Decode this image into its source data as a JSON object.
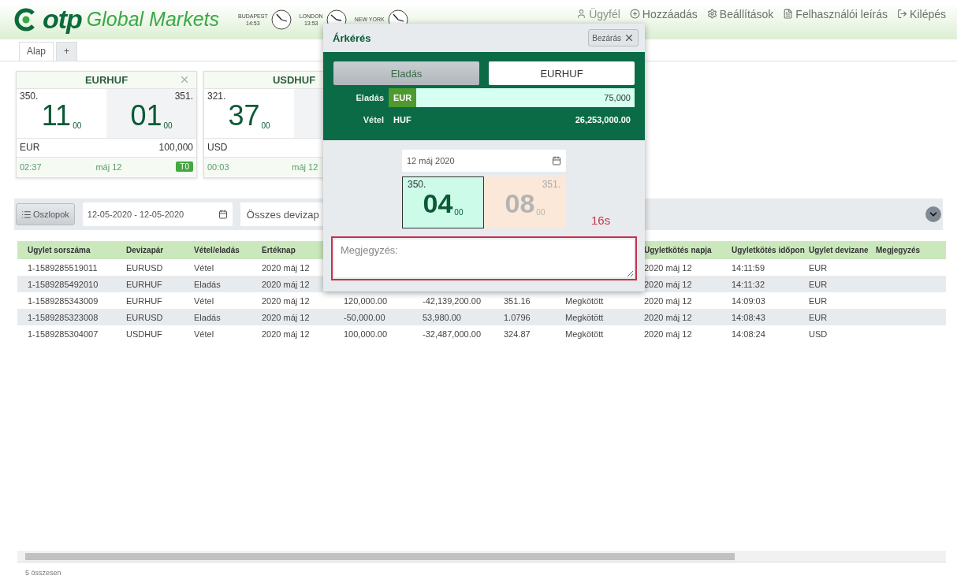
{
  "logo": {
    "brand": "otp",
    "product": "Global Markets"
  },
  "clocks": [
    {
      "city": "BUDAPEST",
      "time": "14:53"
    },
    {
      "city": "LONDON",
      "time": "13:53"
    },
    {
      "city": "NEW YORK"
    }
  ],
  "nav": [
    {
      "kind": "user",
      "label": "Ügyfél",
      "disabled": true
    },
    {
      "kind": "add",
      "label": "Hozzáadás",
      "disabled": false
    },
    {
      "kind": "settings",
      "label": "Beállítások",
      "disabled": false
    },
    {
      "kind": "manual",
      "label": "Felhasználói leírás",
      "disabled": false
    },
    {
      "kind": "logout",
      "label": "Kilépés",
      "disabled": false
    }
  ],
  "tabs": [
    {
      "label": "Alap",
      "selected": true
    },
    {
      "label": "+",
      "selected": false
    }
  ],
  "cards": [
    {
      "pair": "EURHUF",
      "bid": {
        "prefix": "350.",
        "big": "11",
        "small": "00"
      },
      "ask": {
        "prefix": "351.",
        "big": "01",
        "small": "00"
      },
      "currency": "EUR",
      "amount": "100,000",
      "time": "02:37",
      "date": "máj 12",
      "badge": "T0"
    },
    {
      "pair": "USDHUF",
      "bid": {
        "prefix": "321.",
        "big": "37",
        "small": "00"
      },
      "currency": "USD",
      "time": "00:03",
      "date": "máj 12"
    }
  ],
  "toolbar": {
    "columns_button": "Oszlopok",
    "date_range": "12-05-2020 - 12-05-2020",
    "pair_filter": "Összes devizap"
  },
  "table": {
    "columns": [
      "Ügylet sorszáma",
      "Devizapár",
      "Vétel/eladás",
      "Értéknap",
      null,
      null,
      null,
      null,
      "Ügyletkötés napja",
      "Ügyletkötés időpon",
      "Ügylet devizane",
      "Megjegyzés"
    ],
    "rows": [
      [
        "1-1589285519011",
        "EURUSD",
        "Vétel",
        "2020 máj 12",
        null,
        null,
        null,
        null,
        "2020 máj 12",
        "14:11:59",
        "EUR",
        null
      ],
      [
        "1-1589285492010",
        "EURHUF",
        "Eladás",
        "2020 máj 12",
        null,
        null,
        null,
        null,
        "2020 máj 12",
        "14:11:32",
        "EUR",
        null
      ],
      [
        "1-1589285343009",
        "EURHUF",
        "Vétel",
        "2020 máj 12",
        "120,000.00",
        "-42,139,200.00",
        "351.16",
        "Megkötött",
        "2020 máj 12",
        "14:09:03",
        "EUR",
        null
      ],
      [
        "1-1589285323008",
        "EURUSD",
        "Eladás",
        "2020 máj 12",
        "-50,000.00",
        "53,980.00",
        "1.0796",
        "Megkötött",
        "2020 máj 12",
        "14:08:43",
        "EUR",
        null
      ],
      [
        "1-1589285304007",
        "USDHUF",
        "Vétel",
        "2020 máj 12",
        "100,000.00",
        "-32,487,000.00",
        "324.87",
        "Megkötött",
        "2020 máj 12",
        "14:08:24",
        "USD",
        null
      ]
    ]
  },
  "footer": "5 összesen",
  "modal": {
    "title": "Árkérés",
    "close": "Bezárás",
    "side_button": "Eladás",
    "pair_button": "EURHUF",
    "legs": [
      {
        "label": "Eladás",
        "currency": "EUR",
        "amount": "75,000",
        "editable": true
      },
      {
        "label": "Vétel",
        "currency": "HUF",
        "amount": "26,253,000.00",
        "editable": false
      }
    ],
    "value_date": "12 máj 2020",
    "prices": [
      {
        "prefix": "350.",
        "big": "04",
        "small": "00",
        "selected": true
      },
      {
        "prefix": "351.",
        "big": "08",
        "small": "00",
        "selected": false
      }
    ],
    "countdown": "16s",
    "note": {
      "placeholder": "Megjegyzés:",
      "invalid": true
    }
  }
}
